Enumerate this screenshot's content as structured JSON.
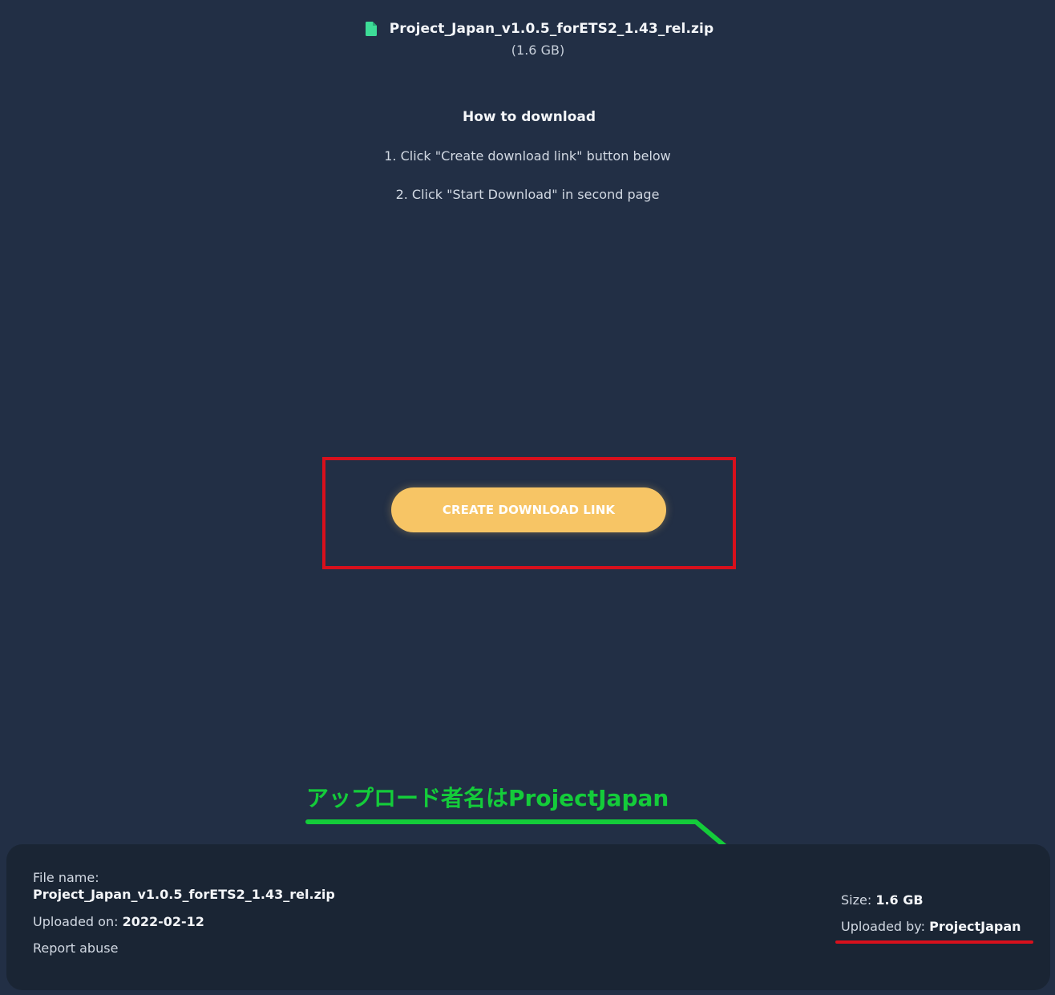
{
  "file": {
    "icon": "file-icon",
    "name": "Project_Japan_v1.0.5_forETS2_1.43_rel.zip",
    "size_display": "(1.6 GB)"
  },
  "instructions": {
    "title": "How to download",
    "steps": [
      "1. Click \"Create download link\" button below",
      "2. Click \"Start Download\" in second page"
    ]
  },
  "cta": {
    "label": "CREATE DOWNLOAD LINK"
  },
  "annotation": {
    "text": "アップロード者名はProjectJapan",
    "colors": {
      "text": "#14cc3a",
      "arrow": "#14cc3a",
      "highlight": "#d8101c"
    }
  },
  "details": {
    "file_name_label": "File name:",
    "file_name": "Project_Japan_v1.0.5_forETS2_1.43_rel.zip",
    "uploaded_on_label": "Uploaded on:",
    "uploaded_on": "2022-02-12",
    "report_label": "Report abuse",
    "size_label": "Size:",
    "size": "1.6 GB",
    "uploaded_by_label": "Uploaded by:",
    "uploaded_by": "ProjectJapan"
  },
  "colors": {
    "background": "#222f45",
    "panel": "#1a2534",
    "accent_button": "#f7c565",
    "file_icon": "#3ddc97"
  }
}
